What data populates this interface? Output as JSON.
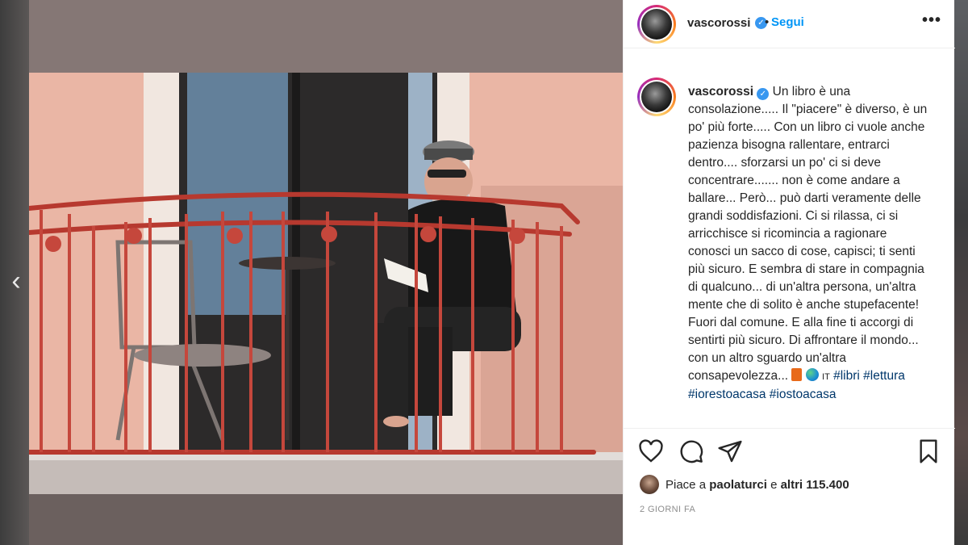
{
  "post": {
    "username": "vascorossi",
    "follow_label": "Segui",
    "follow_separator": "•",
    "more_label": "•••",
    "caption": {
      "username": "vascorossi",
      "text": "Un libro è una consolazione..... Il \"piacere\" è diverso, è un po' più forte..... Con un libro ci vuole anche pazienza bisogna rallentare, entrarci dentro.... sforzarsi un po' ci si deve concentrare....... non è come andare a ballare... Però... può darti veramente delle grandi soddisfazioni. Ci si rilassa, ci si arricchisce si ricomincia a ragionare conosci un sacco di cose, capisci; ti senti più sicuro. E sembra di stare in compagnia di qualcuno... di un'altra persona, un'altra mente che di solito è anche stupefacente! Fuori dal comune. E alla fine ti accorgi di sentirti più sicuro. Di affrontare il mondo... con un altro sguardo un'altra consapevolezza...",
      "lang_label": "IT",
      "hashtags": "#libri #lettura #iorestoacasa #iostoacasa"
    },
    "likes": {
      "prefix": "Piace a",
      "user": "paolaturci",
      "joiner": "e",
      "others": "altri 115.400"
    },
    "timestamp": "2 GIORNI FA"
  },
  "icons": {
    "verified": "verified-badge-icon",
    "like": "heart-icon",
    "comment": "comment-icon",
    "share": "share-icon",
    "save": "bookmark-icon",
    "prev": "chevron-left-icon",
    "book_emoji": "orange-book-icon",
    "globe_emoji": "globe-icon"
  },
  "colors": {
    "link": "#0095f6",
    "hashtag": "#00376b",
    "verified": "#3897f0",
    "muted": "#8e8e8e"
  }
}
